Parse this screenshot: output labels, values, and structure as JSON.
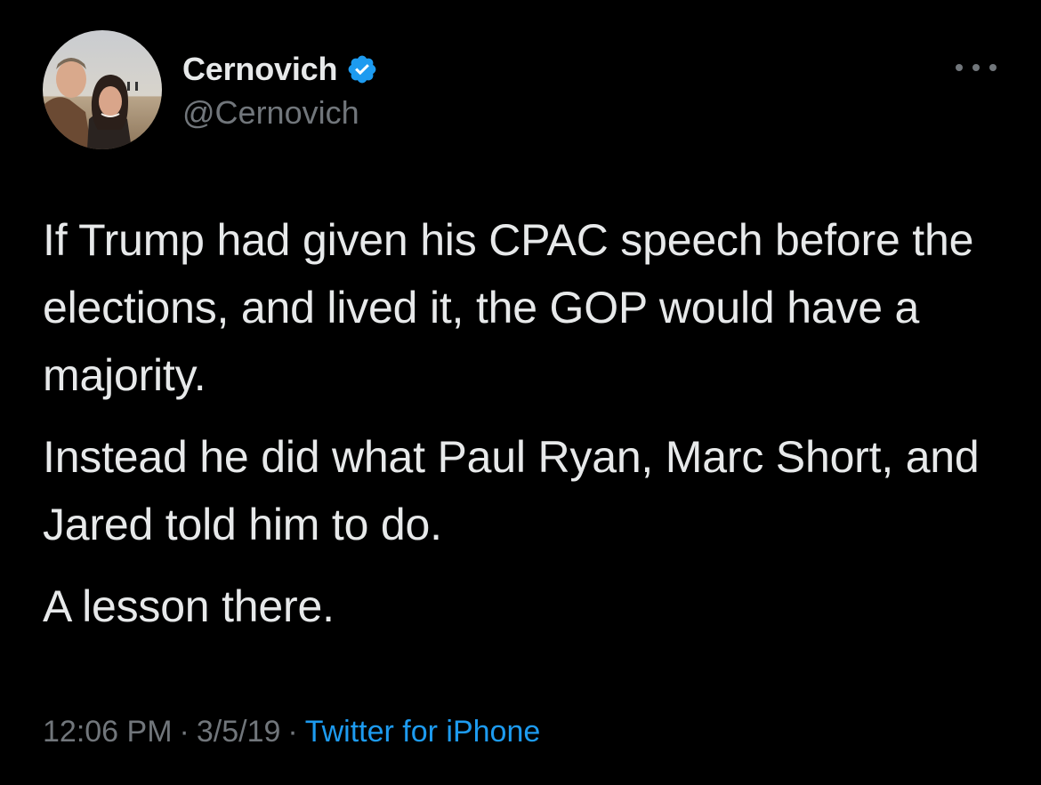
{
  "author": {
    "display_name": "Cernovich",
    "handle": "@Cernovich",
    "verified": true,
    "avatar_icon": "profile-photo"
  },
  "menu_icon": "more-horizontal-icon",
  "tweet": {
    "paragraphs": [
      "If Trump had given his CPAC speech before the elections, and lived it, the GOP would have a majority.",
      "Instead he did what Paul Ryan, Marc Short, and Jared told him to do.",
      "A lesson there."
    ],
    "time": "12:06 PM",
    "separator": "·",
    "date": "3/5/19",
    "source": "Twitter for iPhone"
  },
  "colors": {
    "background": "#000000",
    "text": "#e7e9ea",
    "secondary": "#71767b",
    "accent": "#1d9bf0"
  }
}
